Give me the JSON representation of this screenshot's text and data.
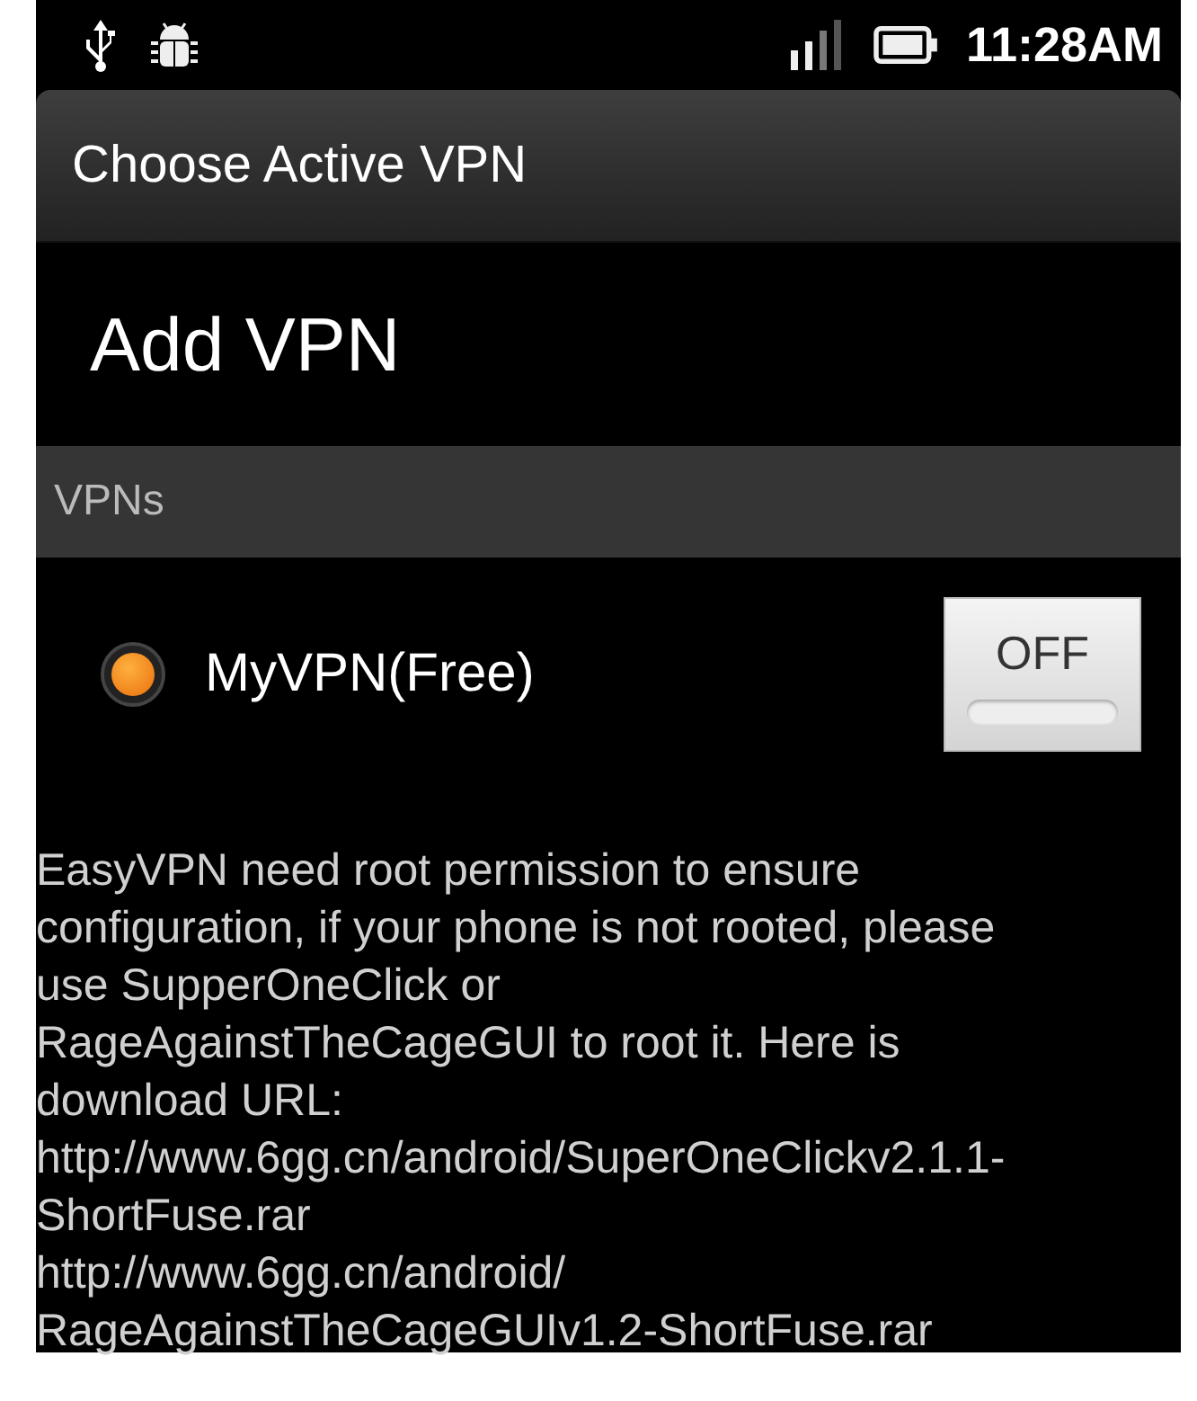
{
  "status_bar": {
    "time": "11:28AM"
  },
  "title_bar": {
    "title": "Choose Active VPN"
  },
  "add_item": {
    "label": "Add VPN"
  },
  "section": {
    "title": "VPNs"
  },
  "vpns": [
    {
      "name": "MyVPN(Free)",
      "selected": true,
      "toggle": {
        "label": "OFF",
        "on": false
      }
    }
  ],
  "message": {
    "lines": [
      "EasyVPN need root permission to ensure",
      "configuration, if your phone is not rooted, please",
      "use SupperOneClick or",
      "RageAgainstTheCageGUI to root it. Here is",
      "download URL:",
      "http://www.6gg.cn/android/SuperOneClickv2.1.1-",
      "ShortFuse.rar",
      "http://www.6gg.cn/android/",
      "RageAgainstTheCageGUIv1.2-ShortFuse.rar"
    ]
  }
}
